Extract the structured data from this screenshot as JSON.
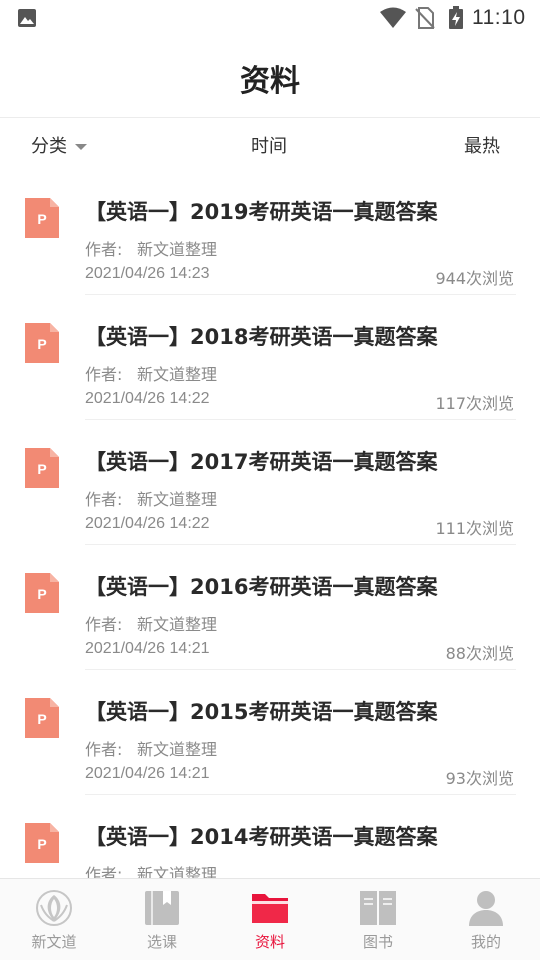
{
  "status_bar": {
    "time": "11:10",
    "icons": [
      "gallery-icon",
      "wifi-icon",
      "no-sim-icon",
      "battery-charging-icon"
    ]
  },
  "header": {
    "title": "资料"
  },
  "filters": {
    "category": "分类",
    "time": "时间",
    "hot": "最热"
  },
  "colors": {
    "accent": "#e8143c",
    "doc_icon": "#f28a74",
    "muted_text": "#8a8a8a",
    "nav_inactive": "#bfbfbf"
  },
  "list": {
    "items": [
      {
        "title": "【英语一】2019考研英语一真题答案",
        "author_label": "作者:",
        "author": "新文道整理",
        "date": "2021/04/26 14:23",
        "views": "944次浏览",
        "icon": "P"
      },
      {
        "title": "【英语一】2018考研英语一真题答案",
        "author_label": "作者:",
        "author": "新文道整理",
        "date": "2021/04/26 14:22",
        "views": "117次浏览",
        "icon": "P"
      },
      {
        "title": "【英语一】2017考研英语一真题答案",
        "author_label": "作者:",
        "author": "新文道整理",
        "date": "2021/04/26 14:22",
        "views": "111次浏览",
        "icon": "P"
      },
      {
        "title": "【英语一】2016考研英语一真题答案",
        "author_label": "作者:",
        "author": "新文道整理",
        "date": "2021/04/26 14:21",
        "views": "88次浏览",
        "icon": "P"
      },
      {
        "title": "【英语一】2015考研英语一真题答案",
        "author_label": "作者:",
        "author": "新文道整理",
        "date": "2021/04/26 14:21",
        "views": "93次浏览",
        "icon": "P"
      },
      {
        "title": "【英语一】2014考研英语一真题答案",
        "author_label": "作者:",
        "author": "新文道整理",
        "date": "",
        "views": "",
        "icon": "P"
      }
    ]
  },
  "bottom_nav": {
    "items": [
      {
        "label": "新文道",
        "icon": "logo-icon",
        "active": false
      },
      {
        "label": "选课",
        "icon": "bookmark-book-icon",
        "active": false
      },
      {
        "label": "资料",
        "icon": "folder-icon",
        "active": true
      },
      {
        "label": "图书",
        "icon": "open-book-icon",
        "active": false
      },
      {
        "label": "我的",
        "icon": "user-icon",
        "active": false
      }
    ]
  }
}
